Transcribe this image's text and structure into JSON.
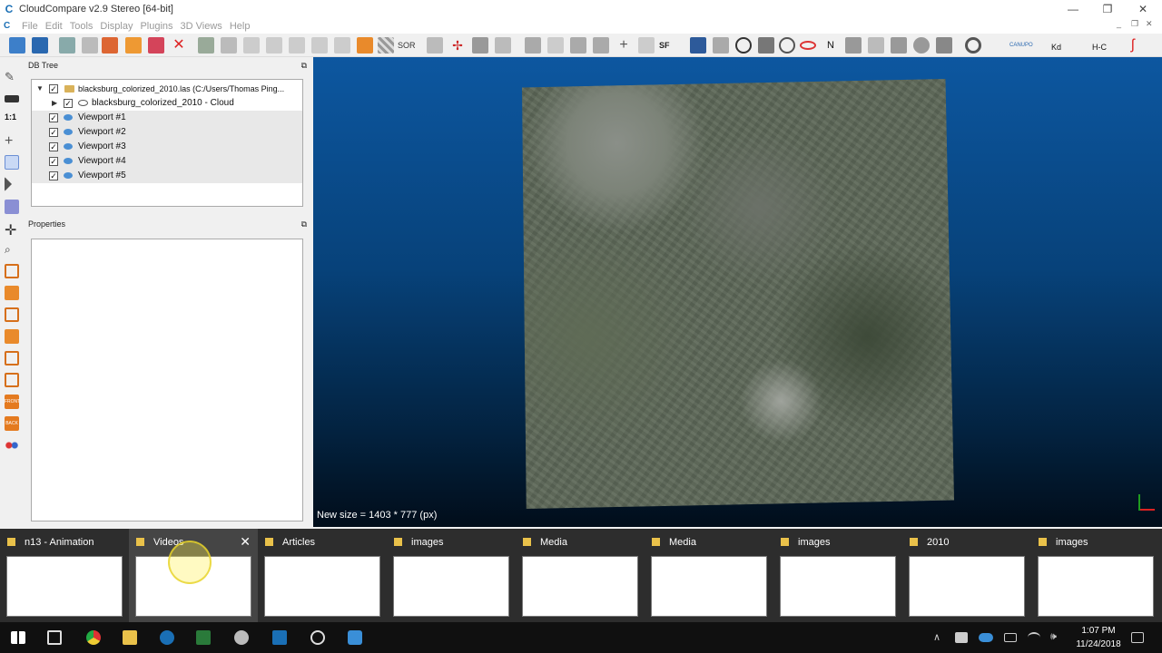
{
  "window": {
    "title": "CloudCompare v2.9 Stereo [64-bit]",
    "app_icon": "C",
    "min": "—",
    "max": "❐",
    "close": "✕"
  },
  "menu": {
    "items": [
      "File",
      "Edit",
      "Tools",
      "Display",
      "Plugins",
      "3D Views",
      "Help"
    ],
    "mdi_min": "_",
    "mdi_max": "❐",
    "mdi_close": "✕"
  },
  "toolbar": {
    "sor_label": "SOR",
    "sf_label": "SF",
    "canupo_label": "CANUPO",
    "kd_label": "Kd",
    "n_label": "N",
    "hc_label": "H-C"
  },
  "left_toolbar": {
    "scale_label": "1:1",
    "front_label": "FRONT",
    "back_label": "BACK"
  },
  "db_tree": {
    "title": "DB Tree",
    "float": "⧉",
    "root": "blacksburg_colorized_2010.las (C:/Users/Thomas Ping...",
    "cloud": "blacksburg_colorized_2010 - Cloud",
    "viewports": [
      "Viewport #1",
      "Viewport #2",
      "Viewport #3",
      "Viewport #4",
      "Viewport #5"
    ]
  },
  "properties": {
    "title": "Properties",
    "float": "⧉"
  },
  "view3d": {
    "status": "New size = 1403 * 777 (px)"
  },
  "thumbnails": [
    {
      "title": "n13 - Animation"
    },
    {
      "title": "Videos"
    },
    {
      "title": "Articles"
    },
    {
      "title": "images"
    },
    {
      "title": "Media"
    },
    {
      "title": "Media"
    },
    {
      "title": "images"
    },
    {
      "title": "2010"
    },
    {
      "title": "images"
    }
  ],
  "taskbar": {
    "time": "1:07 PM",
    "date": "11/24/2018",
    "tray_chevron": "∧",
    "volume": "🕪"
  },
  "colors": {
    "accent": "#1a6fb5",
    "view_top": "#0d57a0",
    "view_bottom": "#010d1a"
  }
}
